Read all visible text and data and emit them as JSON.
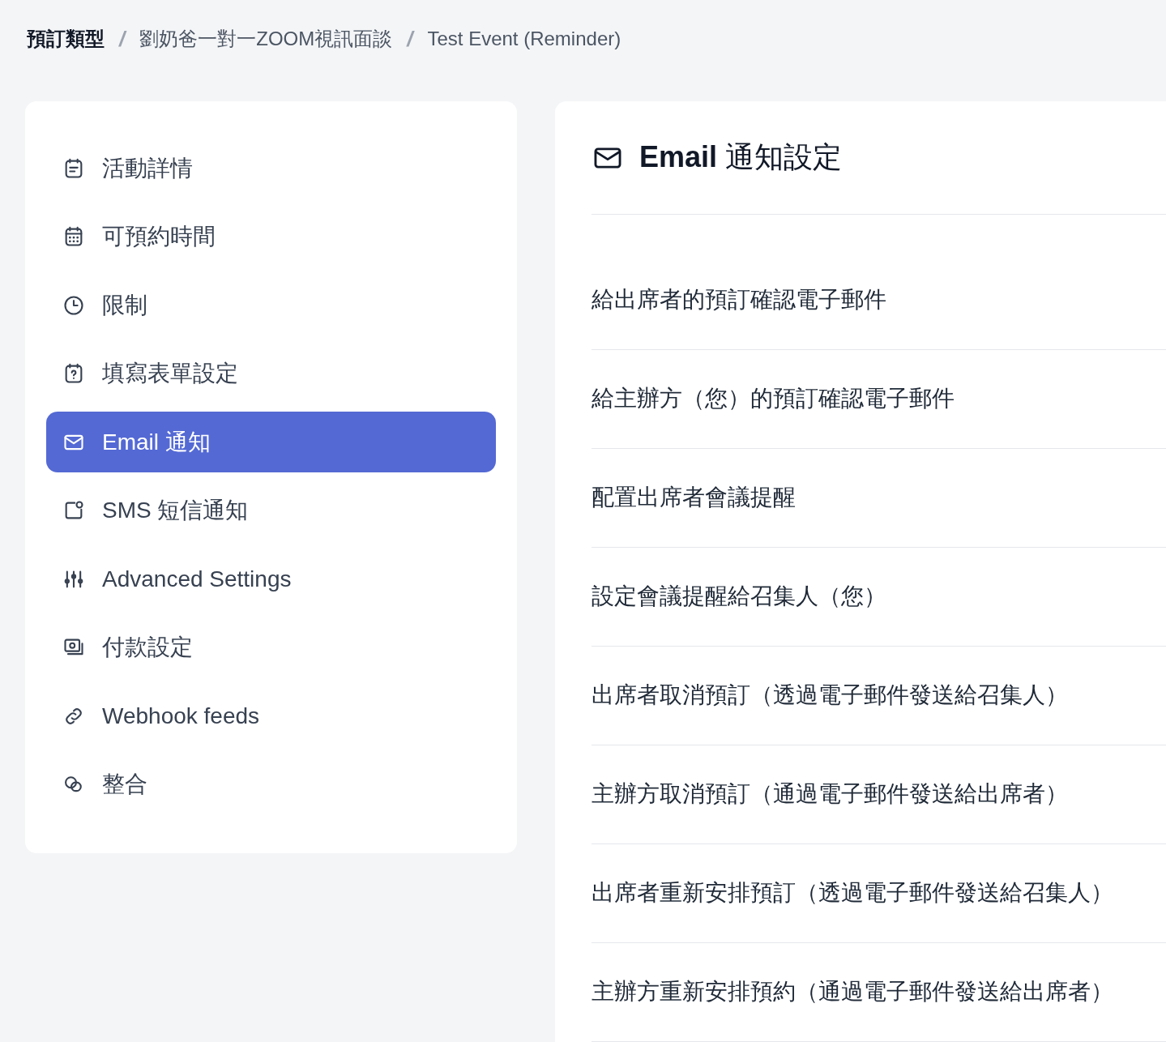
{
  "breadcrumb": [
    {
      "label": "預訂類型"
    },
    {
      "label": "劉奶爸一對一ZOOM視訊面談"
    },
    {
      "label": "Test Event (Reminder)"
    }
  ],
  "breadcrumb_separator": "/",
  "sidebar": {
    "items": [
      {
        "kind": "details",
        "label": "活動詳情",
        "selected": false
      },
      {
        "kind": "calendar",
        "label": "可預約時間",
        "selected": false
      },
      {
        "kind": "clock",
        "label": "限制",
        "selected": false
      },
      {
        "kind": "question",
        "label": "填寫表單設定",
        "selected": false
      },
      {
        "kind": "mail",
        "label": "Email 通知",
        "selected": true
      },
      {
        "kind": "sms",
        "label": "SMS 短信通知",
        "selected": false
      },
      {
        "kind": "sliders",
        "label": "Advanced Settings",
        "selected": false
      },
      {
        "kind": "payment",
        "label": "付款設定",
        "selected": false
      },
      {
        "kind": "link",
        "label": "Webhook feeds",
        "selected": false
      },
      {
        "kind": "integrations",
        "label": "整合",
        "selected": false
      }
    ]
  },
  "panel": {
    "title": "**Email** 通知設定",
    "notifications": [
      {
        "label": "給出席者的預訂確認電子郵件"
      },
      {
        "label": "給主辦方（您）的預訂確認電子郵件"
      },
      {
        "label": "配置出席者會議提醒"
      },
      {
        "label": "設定會議提醒給召集人（您）"
      },
      {
        "label": "出席者取消預訂（透過電子郵件發送給召集人）"
      },
      {
        "label": "主辦方取消預訂（通過電子郵件發送給出席者）"
      },
      {
        "label": "出席者重新安排預訂（透過電子郵件發送給召集人）"
      },
      {
        "label": "主辦方重新安排預約（通過電子郵件發送給出席者）"
      }
    ]
  }
}
